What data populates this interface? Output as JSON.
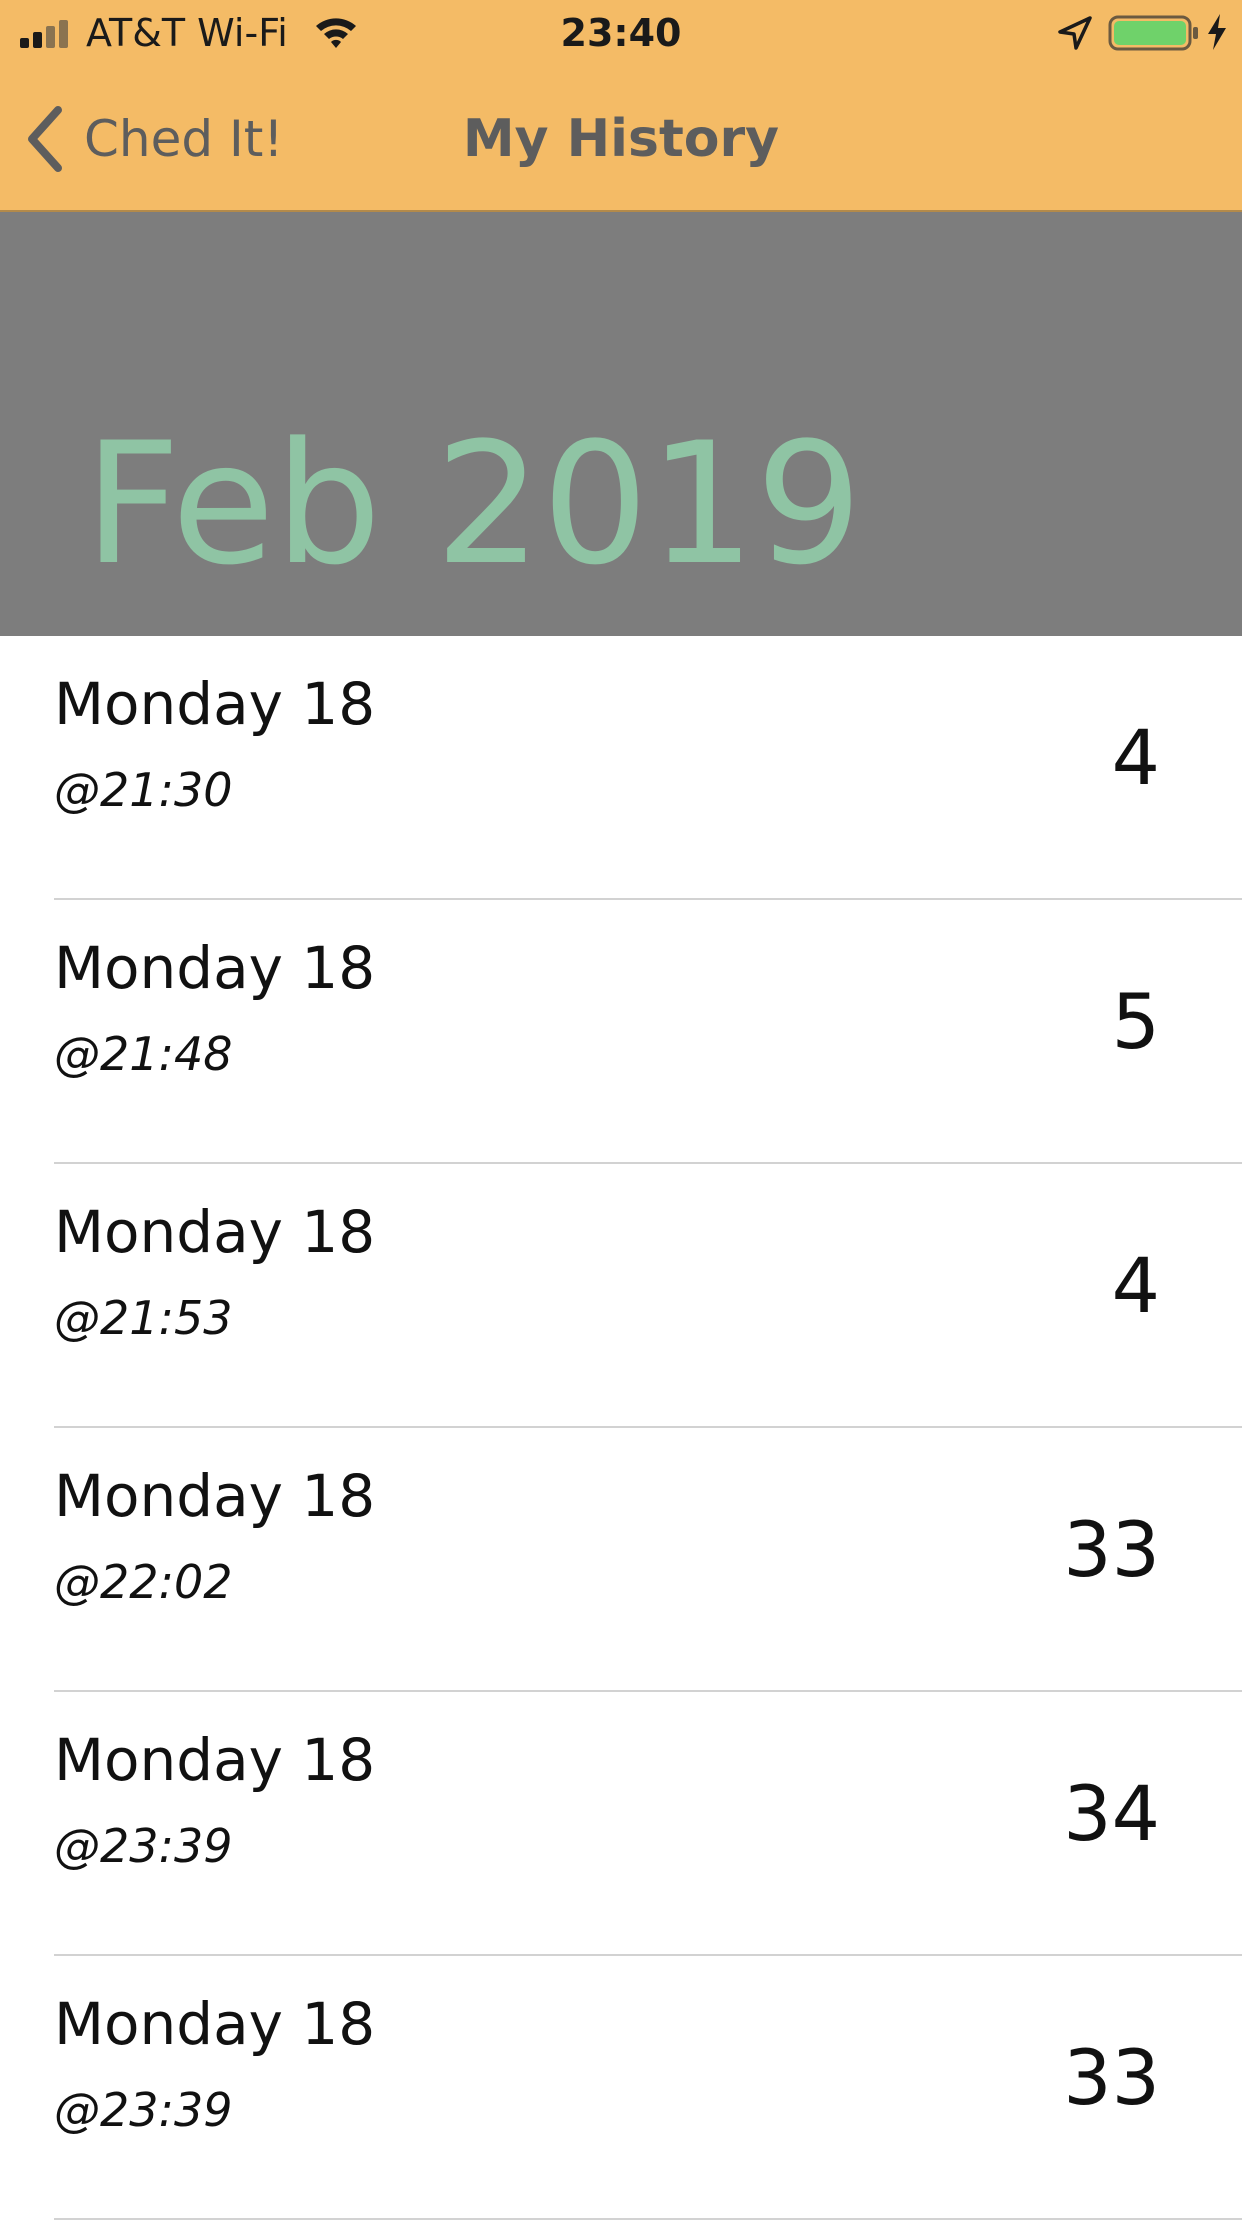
{
  "status_bar": {
    "carrier": "AT&T Wi-Fi",
    "time": "23:40",
    "signal_icon": "cellular-signal-icon",
    "wifi_icon": "wifi-icon",
    "location_icon": "location-arrow-icon",
    "battery_icon": "battery-charging-icon",
    "battery_color": "#6fd26a"
  },
  "nav": {
    "back_label": "Ched It!",
    "title": "My History",
    "bar_color": "#f4bb66"
  },
  "month_section": {
    "label": "Feb 2019",
    "background": "#7d7d7d",
    "text_color": "#8fc4a4"
  },
  "history": [
    {
      "day": "Monday 18",
      "time": "@21:30",
      "count": "4"
    },
    {
      "day": "Monday 18",
      "time": "@21:48",
      "count": "5"
    },
    {
      "day": "Monday 18",
      "time": "@21:53",
      "count": "4"
    },
    {
      "day": "Monday 18",
      "time": "@22:02",
      "count": "33"
    },
    {
      "day": "Monday 18",
      "time": "@23:39",
      "count": "34"
    },
    {
      "day": "Monday 18",
      "time": "@23:39",
      "count": "33"
    }
  ]
}
